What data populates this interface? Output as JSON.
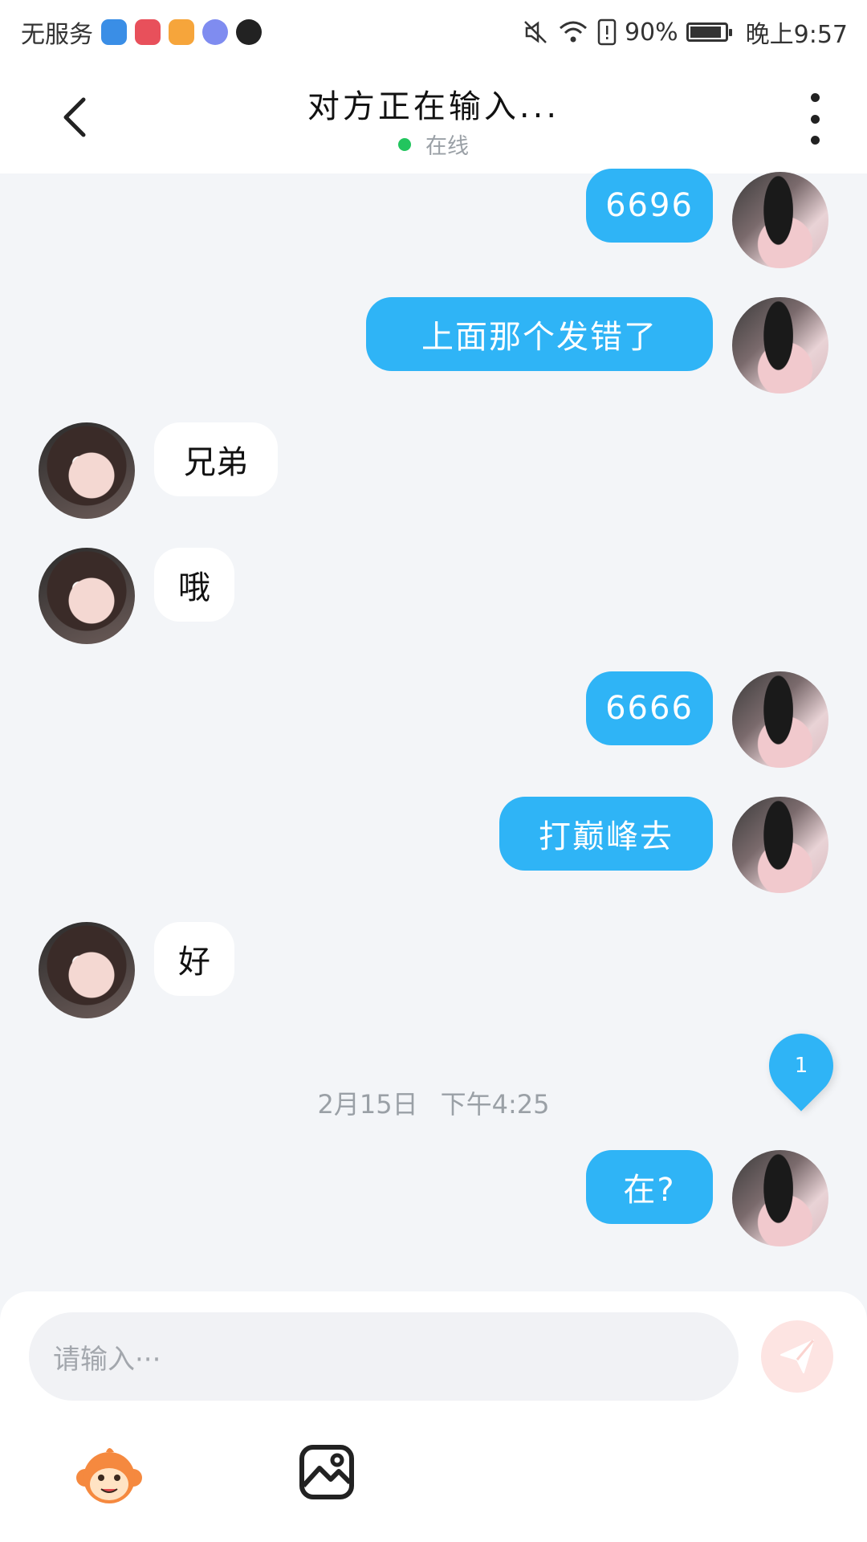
{
  "status_bar": {
    "carrier": "无服务",
    "battery_percent": "90%",
    "battery_level": 0.9,
    "time": "晚上9:57",
    "app_icons": [
      "security-app-icon",
      "huawei-store-icon",
      "video-app-icon",
      "music-app-icon",
      "tiktok-icon"
    ]
  },
  "header": {
    "title": "对方正在输入...",
    "presence": "在线",
    "presence_color": "#22c55e"
  },
  "messages": [
    {
      "sender": "me",
      "text": "6696"
    },
    {
      "sender": "me",
      "text": "上面那个发错了"
    },
    {
      "sender": "peer",
      "text": "兄弟"
    },
    {
      "sender": "peer",
      "text": "哦"
    },
    {
      "sender": "me",
      "text": "6666"
    },
    {
      "sender": "me",
      "text": "打巅峰去"
    },
    {
      "sender": "peer",
      "text": "好"
    },
    {
      "sender": "me",
      "text": "在?"
    }
  ],
  "timestamp": {
    "date": "2月15日",
    "time": "下午4:25"
  },
  "unread_count": "1",
  "composer": {
    "placeholder": "请输入···"
  },
  "colors": {
    "my_bubble": "#2fb4f6",
    "peer_bubble": "#ffffff",
    "background": "#f3f5f8",
    "send_button_disabled": "#fde4e2"
  }
}
